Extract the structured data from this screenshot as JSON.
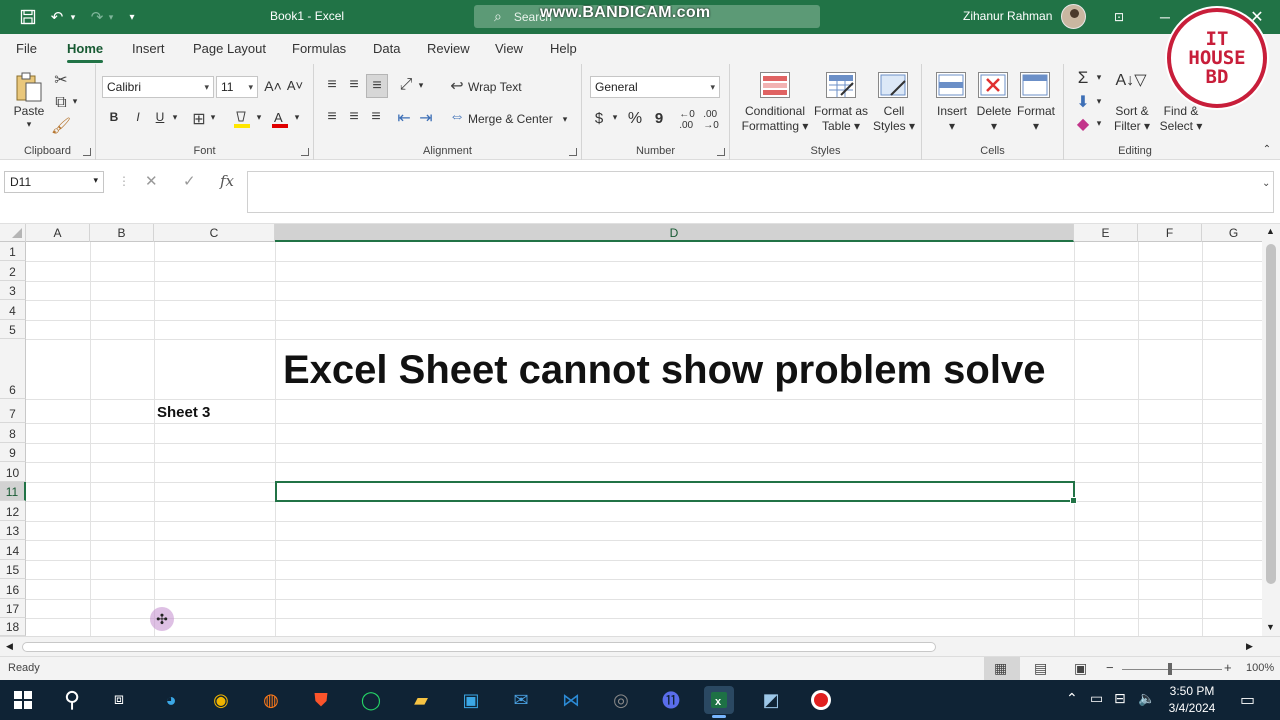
{
  "titlebar": {
    "title": "Book1  -  Excel",
    "search_placeholder": "Search",
    "watermark": "www.BANDICAM.com",
    "user": "Zihanur Rahman"
  },
  "logo": {
    "line1": "IT",
    "line2": "HOUSE",
    "line3": "BD"
  },
  "menu": [
    "File",
    "Home",
    "Insert",
    "Page Layout",
    "Formulas",
    "Data",
    "Review",
    "View",
    "Help"
  ],
  "ribbon": {
    "clipboard": {
      "label": "Clipboard",
      "paste": "Paste"
    },
    "font": {
      "label": "Font",
      "name": "Calibri",
      "size": "11",
      "bold": "B",
      "italic": "I",
      "underline": "U"
    },
    "alignment": {
      "label": "Alignment",
      "wrap": "Wrap Text",
      "merge": "Merge & Center"
    },
    "number": {
      "label": "Number",
      "format": "General",
      "currency": "$",
      "percent": "%",
      "comma": "9"
    },
    "styles": {
      "label": "Styles",
      "cond1": "Conditional",
      "cond2": "Formatting",
      "fmt1": "Format as",
      "fmt2": "Table",
      "cell1": "Cell",
      "cell2": "Styles"
    },
    "cells": {
      "label": "Cells",
      "insert": "Insert",
      "delete": "Delete",
      "format": "Format"
    },
    "editing": {
      "label": "Editing",
      "sort1": "Sort &",
      "sort2": "Filter",
      "find1": "Find &",
      "find2": "Select"
    }
  },
  "formula": {
    "namebox": "D11",
    "fx": "fx",
    "value": ""
  },
  "grid": {
    "columns": [
      "A",
      "B",
      "C",
      "D",
      "E",
      "F",
      "G"
    ],
    "rows": [
      "1",
      "2",
      "3",
      "4",
      "5",
      "6",
      "7",
      "8",
      "9",
      "10",
      "11",
      "12",
      "13",
      "14",
      "15",
      "16",
      "17",
      "18"
    ],
    "d6": "Excel Sheet cannot show problem solve",
    "c7": "Sheet 3"
  },
  "status": {
    "ready": "Ready",
    "zoom": "100%"
  },
  "clock": {
    "time": "3:50 PM",
    "date": "3/4/2024"
  }
}
